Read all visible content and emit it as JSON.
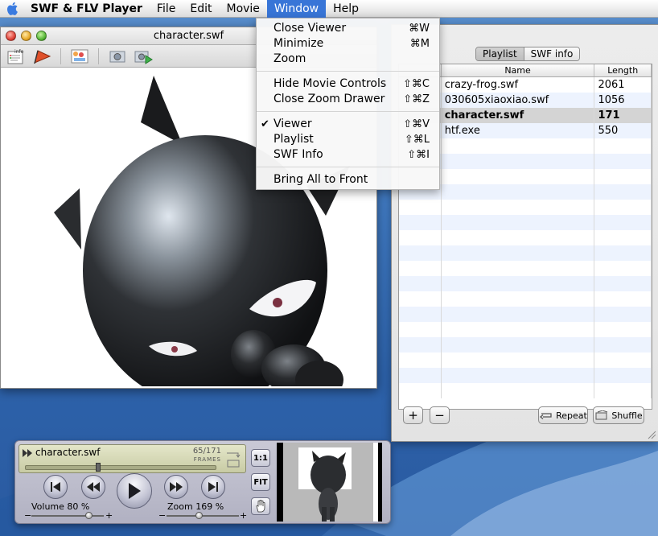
{
  "menubar": {
    "app_name": "SWF & FLV Player",
    "items": [
      "File",
      "Edit",
      "Movie",
      "Window",
      "Help"
    ],
    "active_item": "Window"
  },
  "window_menu": {
    "groups": [
      [
        {
          "label": "Close Viewer",
          "shortcut": "⌘W"
        },
        {
          "label": "Minimize",
          "shortcut": "⌘M"
        },
        {
          "label": "Zoom",
          "shortcut": ""
        }
      ],
      [
        {
          "label": "Hide Movie Controls",
          "shortcut": "⇧⌘C"
        },
        {
          "label": "Close Zoom Drawer",
          "shortcut": "⇧⌘Z"
        }
      ],
      [
        {
          "label": "Viewer",
          "shortcut": "⇧⌘V",
          "checked": true
        },
        {
          "label": "Playlist",
          "shortcut": "⇧⌘L"
        },
        {
          "label": "SWF Info",
          "shortcut": "⇧⌘I"
        }
      ],
      [
        {
          "label": "Bring All to Front",
          "shortcut": ""
        }
      ]
    ],
    "check_glyph": "✔"
  },
  "viewer": {
    "title": "character.swf",
    "toolbar_icons": [
      "info-icon",
      "flag-icon",
      "image-palette-icon",
      "camera-icon",
      "camera-play-icon"
    ],
    "toolbar_info_label": "info"
  },
  "playlist": {
    "tabs": [
      "Playlist",
      "SWF info"
    ],
    "selected_tab": "Playlist",
    "columns": [
      "",
      "Name",
      "Length"
    ],
    "rows": [
      {
        "name": "crazy-frog.swf",
        "length": "2061"
      },
      {
        "name": "030605xiaoxiao.swf",
        "length": "1056"
      },
      {
        "name": "character.swf",
        "length": "171",
        "selected": true
      },
      {
        "name": "htf.exe",
        "length": "550"
      }
    ],
    "empty_rows": 17,
    "add_label": "+",
    "remove_label": "−",
    "repeat_label": "Repeat",
    "shuffle_label": "Shuffle"
  },
  "controller": {
    "file_name": "character.swf",
    "frames_text": "65/171",
    "frames_caption": "FRAMES",
    "progress": 0.38,
    "volume_label": "Volume 80 %",
    "volume": 0.8,
    "zoom_label": "Zoom 169 %",
    "zoom": 0.45,
    "one_to_one_label": "1:1",
    "fit_label": "FIT",
    "minus": "−",
    "plus": "+"
  },
  "colors": {
    "menu_highlight": "#3875d7",
    "row_stripe": "#edf3fe",
    "selected_row": "#d4d4d4"
  }
}
